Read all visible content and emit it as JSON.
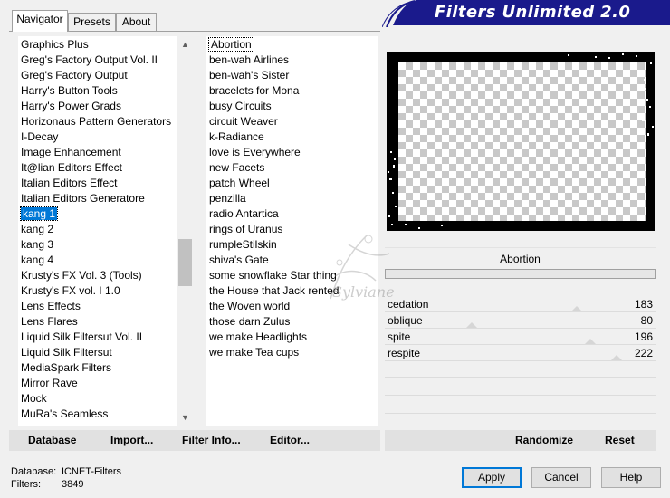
{
  "tabs": [
    {
      "label": "Navigator",
      "active": true
    },
    {
      "label": "Presets",
      "active": false
    },
    {
      "label": "About",
      "active": false
    }
  ],
  "app_title": "Filters Unlimited 2.0",
  "categories": [
    "Graphics Plus",
    "Greg's Factory Output Vol. II",
    "Greg's Factory Output",
    "Harry's Button Tools",
    "Harry's Power Grads",
    "Horizonaus Pattern Generators",
    "I-Decay",
    "Image Enhancement",
    "It@lian Editors Effect",
    "Italian Editors Effect",
    "Italian Editors Generatore",
    "kang 1",
    "kang 2",
    "kang 3",
    "kang 4",
    "Krusty's FX Vol. 3 (Tools)",
    "Krusty's FX vol. I 1.0",
    "Lens Effects",
    "Lens Flares",
    "Liquid Silk Filtersut Vol. II",
    "Liquid Silk Filtersut",
    "MediaSpark Filters",
    "Mirror Rave",
    "Mock",
    "MuRa's Seamless"
  ],
  "selected_category": "kang 1",
  "filters": [
    "Abortion",
    "ben-wah Airlines",
    "ben-wah's Sister",
    "bracelets for Mona",
    "busy Circuits",
    "circuit Weaver",
    "k-Radiance",
    "love is Everywhere",
    "new Facets",
    "patch Wheel",
    "penzilla",
    "radio Antartica",
    "rings of Uranus",
    "rumpleStilskin",
    "shiva's Gate",
    "some snowflake Star thing",
    "the House that Jack rented",
    "the Woven world",
    "those darn Zulus",
    "we make Headlights",
    "we make Tea cups"
  ],
  "selected_filter": "Abortion",
  "current_filter_name": "Abortion",
  "params": [
    {
      "label": "cedation",
      "value": "183",
      "level": 0.718
    },
    {
      "label": "oblique",
      "value": "80",
      "level": 0.314
    },
    {
      "label": "spite",
      "value": "196",
      "level": 0.769
    },
    {
      "label": "respite",
      "value": "222",
      "level": 0.871
    }
  ],
  "watermark": "Sylviane",
  "buttons": {
    "database": "Database",
    "import": "Import...",
    "filter_info": "Filter Info...",
    "editor": "Editor...",
    "randomize": "Randomize",
    "reset": "Reset",
    "apply": "Apply",
    "cancel": "Cancel",
    "help": "Help"
  },
  "status": {
    "database_label": "Database:",
    "database_value": "ICNET-Filters",
    "filters_label": "Filters:",
    "filters_value": "3849"
  },
  "colors": {
    "banner": "#1a1a8c",
    "selection": "#0078d7"
  }
}
